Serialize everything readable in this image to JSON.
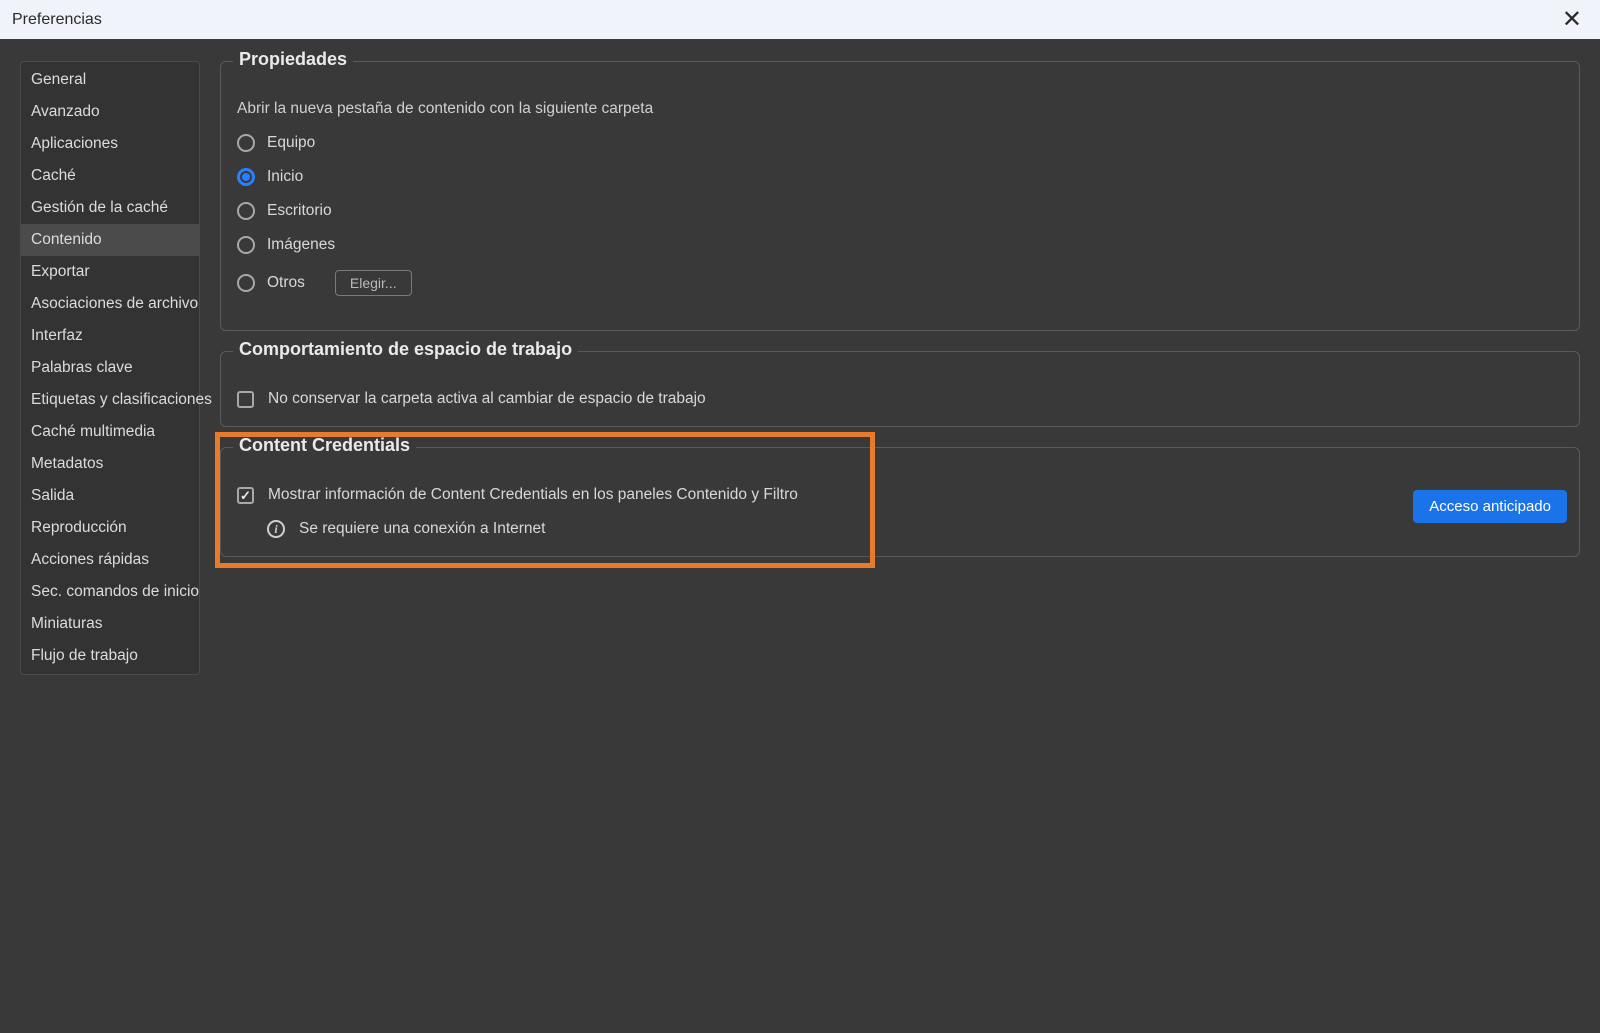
{
  "window": {
    "title": "Preferencias"
  },
  "sidebar": {
    "items": [
      {
        "label": "General"
      },
      {
        "label": "Avanzado"
      },
      {
        "label": "Aplicaciones"
      },
      {
        "label": "Caché"
      },
      {
        "label": "Gestión de la caché"
      },
      {
        "label": "Contenido",
        "selected": true
      },
      {
        "label": "Exportar"
      },
      {
        "label": "Asociaciones de archivo"
      },
      {
        "label": "Interfaz"
      },
      {
        "label": "Palabras clave"
      },
      {
        "label": "Etiquetas y clasificaciones"
      },
      {
        "label": "Caché multimedia"
      },
      {
        "label": "Metadatos"
      },
      {
        "label": "Salida"
      },
      {
        "label": "Reproducción"
      },
      {
        "label": "Acciones rápidas"
      },
      {
        "label": "Sec. comandos de inicio"
      },
      {
        "label": "Miniaturas"
      },
      {
        "label": "Flujo de trabajo"
      }
    ]
  },
  "properties": {
    "legend": "Propiedades",
    "description": "Abrir la nueva pestaña de contenido con la siguiente carpeta",
    "radios": [
      {
        "label": "Equipo"
      },
      {
        "label": "Inicio",
        "selected": true
      },
      {
        "label": "Escritorio"
      },
      {
        "label": "Imágenes"
      },
      {
        "label": "Otros"
      }
    ],
    "choose_label": "Elegir..."
  },
  "workspace": {
    "legend": "Comportamiento de espacio de trabajo",
    "checkbox_label": "No conservar la carpeta activa al cambiar de espacio de trabajo",
    "checked": false
  },
  "credentials": {
    "legend": "Content Credentials",
    "checkbox_label": "Mostrar información de Content Credentials en los paneles Contenido y Filtro",
    "checked": true,
    "info_text": "Se requiere una conexión a Internet",
    "button_label": "Acceso anticipado"
  }
}
